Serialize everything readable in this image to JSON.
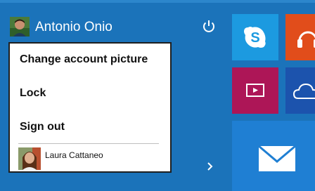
{
  "account": {
    "user_name": "Antonio Onio",
    "menu": {
      "items": [
        "Change account picture",
        "Lock",
        "Sign out"
      ],
      "other_user": "Laura Cattaneo"
    }
  },
  "icons": {
    "power": "power-icon",
    "expand": "chevron-right-icon",
    "tiles": [
      "skype-icon",
      "headphones-icon",
      "video-icon",
      "onedrive-icon",
      "mail-icon"
    ]
  },
  "colors": {
    "background": "#1b73ba",
    "skype_tile": "#1c9ae0",
    "music_tile": "#e14d1b",
    "video_tile": "#ad1657",
    "onedrive_tile": "#1c53ad",
    "mail_tile": "#1f7fd3"
  }
}
